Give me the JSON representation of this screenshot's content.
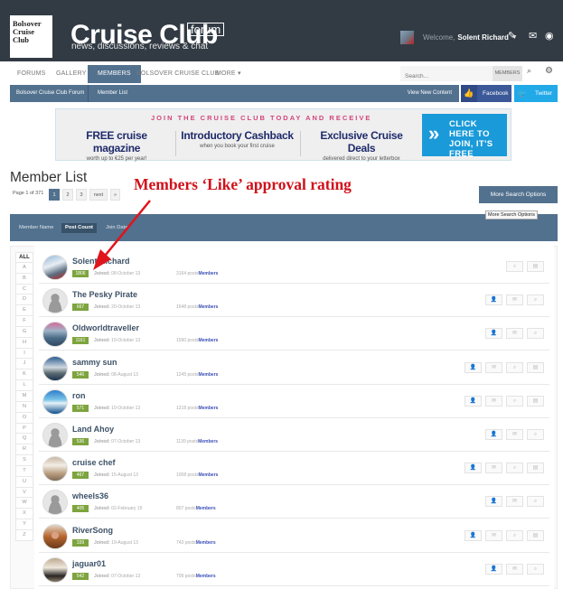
{
  "header": {
    "logo_lines": [
      "Bolsover",
      "Cruise",
      "Club"
    ],
    "brand": "Cruise Club",
    "brand_tag": "forum",
    "tagline": "news, discussions, reviews & chat",
    "welcome_prefix": "Welcome,",
    "username": "Solent Richard",
    "icons": [
      "brush-icon",
      "mail-icon",
      "globe-icon"
    ]
  },
  "nav": {
    "items": [
      {
        "label": "Forums",
        "active": false
      },
      {
        "label": "Gallery",
        "active": false
      },
      {
        "label": "Members",
        "active": true
      },
      {
        "label": "Bolsover Cruise Club",
        "active": false
      },
      {
        "label": "More ▾",
        "active": false
      }
    ],
    "search_placeholder": "Search...",
    "search_scope": "MEMBERS"
  },
  "breadcrumb": {
    "items": [
      "Bolsover Cruise Club Forum",
      "Member List"
    ],
    "view_new_content": "View New Content",
    "facebook": "Facebook",
    "twitter": "Twitter"
  },
  "banner": {
    "headline": "JOIN THE CRUISE CLUB TODAY AND RECEIVE",
    "columns": [
      {
        "title": "FREE cruise magazine",
        "sub": "worth up to €25 per year!"
      },
      {
        "title": "Introductory Cashback",
        "sub": "when you book your first cruise"
      },
      {
        "title": "Exclusive Cruise Deals",
        "sub": "delivered direct to your letterbox"
      }
    ],
    "cta": "CLICK HERE TO JOIN, IT'S FREE",
    "cta_color": "#1a9ad9"
  },
  "page": {
    "title": "Member List",
    "pager_label": "Page 1 of 371",
    "pages": [
      "1",
      "2",
      "3",
      "next",
      "»"
    ],
    "current_page": "1",
    "annotation": "Members ‘Like’ approval rating",
    "more_search_options": "More Search Options",
    "tooltip": "More Search Options"
  },
  "sort": {
    "options": [
      {
        "label": "Member Name",
        "active": false
      },
      {
        "label": "Post Count",
        "active": true
      },
      {
        "label": "Join Date",
        "active": false
      }
    ]
  },
  "alphabet": [
    "ALL",
    "A",
    "B",
    "C",
    "D",
    "E",
    "F",
    "G",
    "H",
    "I",
    "J",
    "K",
    "L",
    "M",
    "N",
    "O",
    "P",
    "Q",
    "R",
    "S",
    "T",
    "U",
    "V",
    "W",
    "X",
    "Y",
    "Z"
  ],
  "members": [
    {
      "name": "Solent Richard",
      "likes": "1806",
      "joined_label": "Joined:",
      "joined": "08-October 13",
      "posts": "3164 posts",
      "group": "Members",
      "avatar": "photo1",
      "actions": [
        "find-content",
        "view-card"
      ]
    },
    {
      "name": "The Pesky Pirate",
      "likes": "667",
      "joined_label": "Joined:",
      "joined": "20-October 13",
      "posts": "1648 posts",
      "group": "Members",
      "avatar": "default",
      "actions": [
        "add-friend",
        "message",
        "find-content"
      ]
    },
    {
      "name": "Oldworldtraveller",
      "likes": "1161",
      "joined_label": "Joined:",
      "joined": "10-October 13",
      "posts": "1590 posts",
      "group": "Members",
      "avatar": "photo2",
      "actions": [
        "add-friend",
        "message",
        "find-content"
      ]
    },
    {
      "name": "sammy sun",
      "likes": "546",
      "joined_label": "Joined:",
      "joined": "08-August 13",
      "posts": "1245 posts",
      "group": "Members",
      "avatar": "photo3",
      "actions": [
        "add-friend",
        "message",
        "find-content",
        "view-card"
      ]
    },
    {
      "name": "ron",
      "likes": "571",
      "joined_label": "Joined:",
      "joined": "10-October 13",
      "posts": "1218 posts",
      "group": "Members",
      "avatar": "photo4",
      "actions": [
        "add-friend",
        "message",
        "find-content",
        "view-card"
      ]
    },
    {
      "name": "Land Ahoy",
      "likes": "536",
      "joined_label": "Joined:",
      "joined": "07-October 13",
      "posts": "1139 posts",
      "group": "Members",
      "avatar": "default",
      "actions": [
        "friend",
        "message",
        "find-content"
      ]
    },
    {
      "name": "cruise chef",
      "likes": "467",
      "joined_label": "Joined:",
      "joined": "15-August 13",
      "posts": "1008 posts",
      "group": "Members",
      "avatar": "photo5",
      "actions": [
        "add-friend",
        "message",
        "find-content",
        "view-card"
      ]
    },
    {
      "name": "wheels36",
      "likes": "405",
      "joined_label": "Joined:",
      "joined": "02-February 15",
      "posts": "807 posts",
      "group": "Members",
      "avatar": "default",
      "actions": [
        "friend",
        "message",
        "find-content"
      ]
    },
    {
      "name": "RiverSong",
      "likes": "339",
      "joined_label": "Joined:",
      "joined": "19-August 13",
      "posts": "743 posts",
      "group": "Members",
      "avatar": "photo6",
      "actions": [
        "friend",
        "message",
        "find-content",
        "view-card"
      ]
    },
    {
      "name": "jaguar01",
      "likes": "542",
      "joined_label": "Joined:",
      "joined": "07-October 13",
      "posts": "709 posts",
      "group": "Members",
      "avatar": "photo7",
      "actions": [
        "add-friend",
        "message",
        "find-content"
      ]
    }
  ],
  "colors": {
    "header_bg": "#323b44",
    "accent": "#52718e",
    "like_badge": "#7da43e",
    "annotation": "#d0111a",
    "facebook": "#3b5998",
    "twitter": "#22a9e8"
  }
}
